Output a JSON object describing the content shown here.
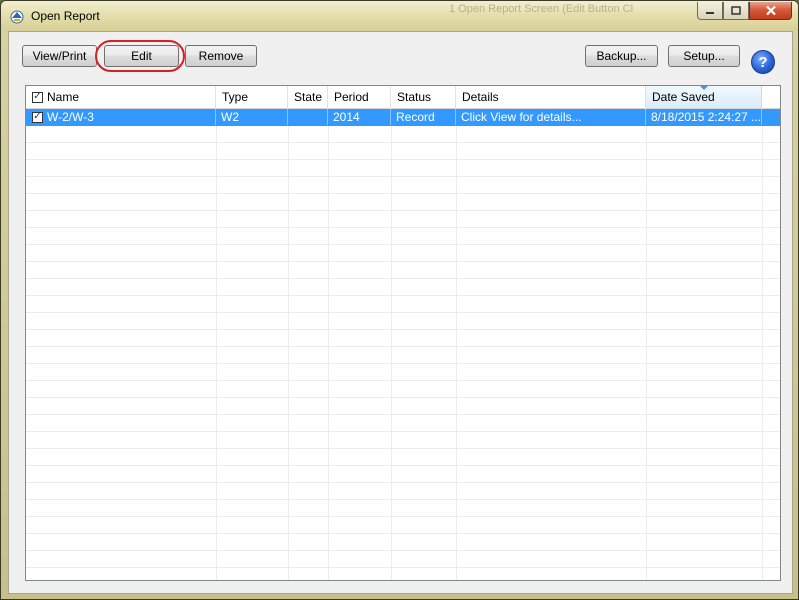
{
  "window": {
    "title": "Open Report",
    "ghost_caption": "1  Open Report Screen (Edit Button Cl"
  },
  "toolbar": {
    "view_print": "View/Print",
    "edit": "Edit",
    "remove": "Remove",
    "backup": "Backup...",
    "setup": "Setup...",
    "help": "?"
  },
  "grid": {
    "columns": [
      "Name",
      "Type",
      "State",
      "Period",
      "Status",
      "Details",
      "Date Saved"
    ],
    "rows": [
      {
        "checked": true,
        "name": "W-2/W-3",
        "type": "W2",
        "state": "",
        "period": "2014",
        "status": "Record",
        "details": "Click View for details...",
        "date_saved": "8/18/2015 2:24:27 ..."
      }
    ],
    "sorted_column": "Date Saved"
  },
  "icons": {
    "app": "app-logo-icon",
    "minimize": "minimize-icon",
    "maximize": "maximize-icon",
    "close": "close-icon",
    "help": "help-icon"
  },
  "colors": {
    "selection": "#3399ff",
    "highlight_ring": "#d62020",
    "close_button": "#c23b1c"
  }
}
